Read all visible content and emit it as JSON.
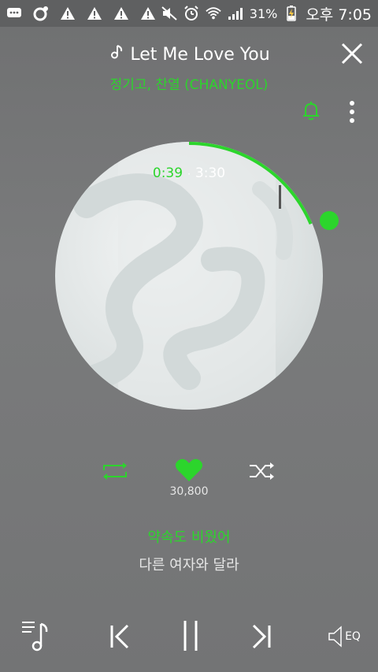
{
  "status_bar": {
    "battery": "31%",
    "time": "오후 7:05",
    "icons": [
      "message-icon",
      "music-app-icon",
      "warning-icon",
      "warning-icon",
      "warning-icon",
      "warning-icon",
      "mute-icon",
      "alarm-icon",
      "wifi-icon",
      "signal-icon",
      "battery-charging-icon"
    ]
  },
  "player": {
    "title": "Let Me Love You",
    "artist": "정기고, 찬열 (CHANYEOL)",
    "current_time": "0:39",
    "total_time": "3:30",
    "progress_fraction": 0.186,
    "likes": "30,800",
    "lyrics": {
      "current": "약속도 비웠어",
      "next": "다른 여자와 달라"
    }
  },
  "controls": {
    "eq_label": "EQ"
  },
  "colors": {
    "accent": "#2cd52c",
    "background": "#737475"
  }
}
